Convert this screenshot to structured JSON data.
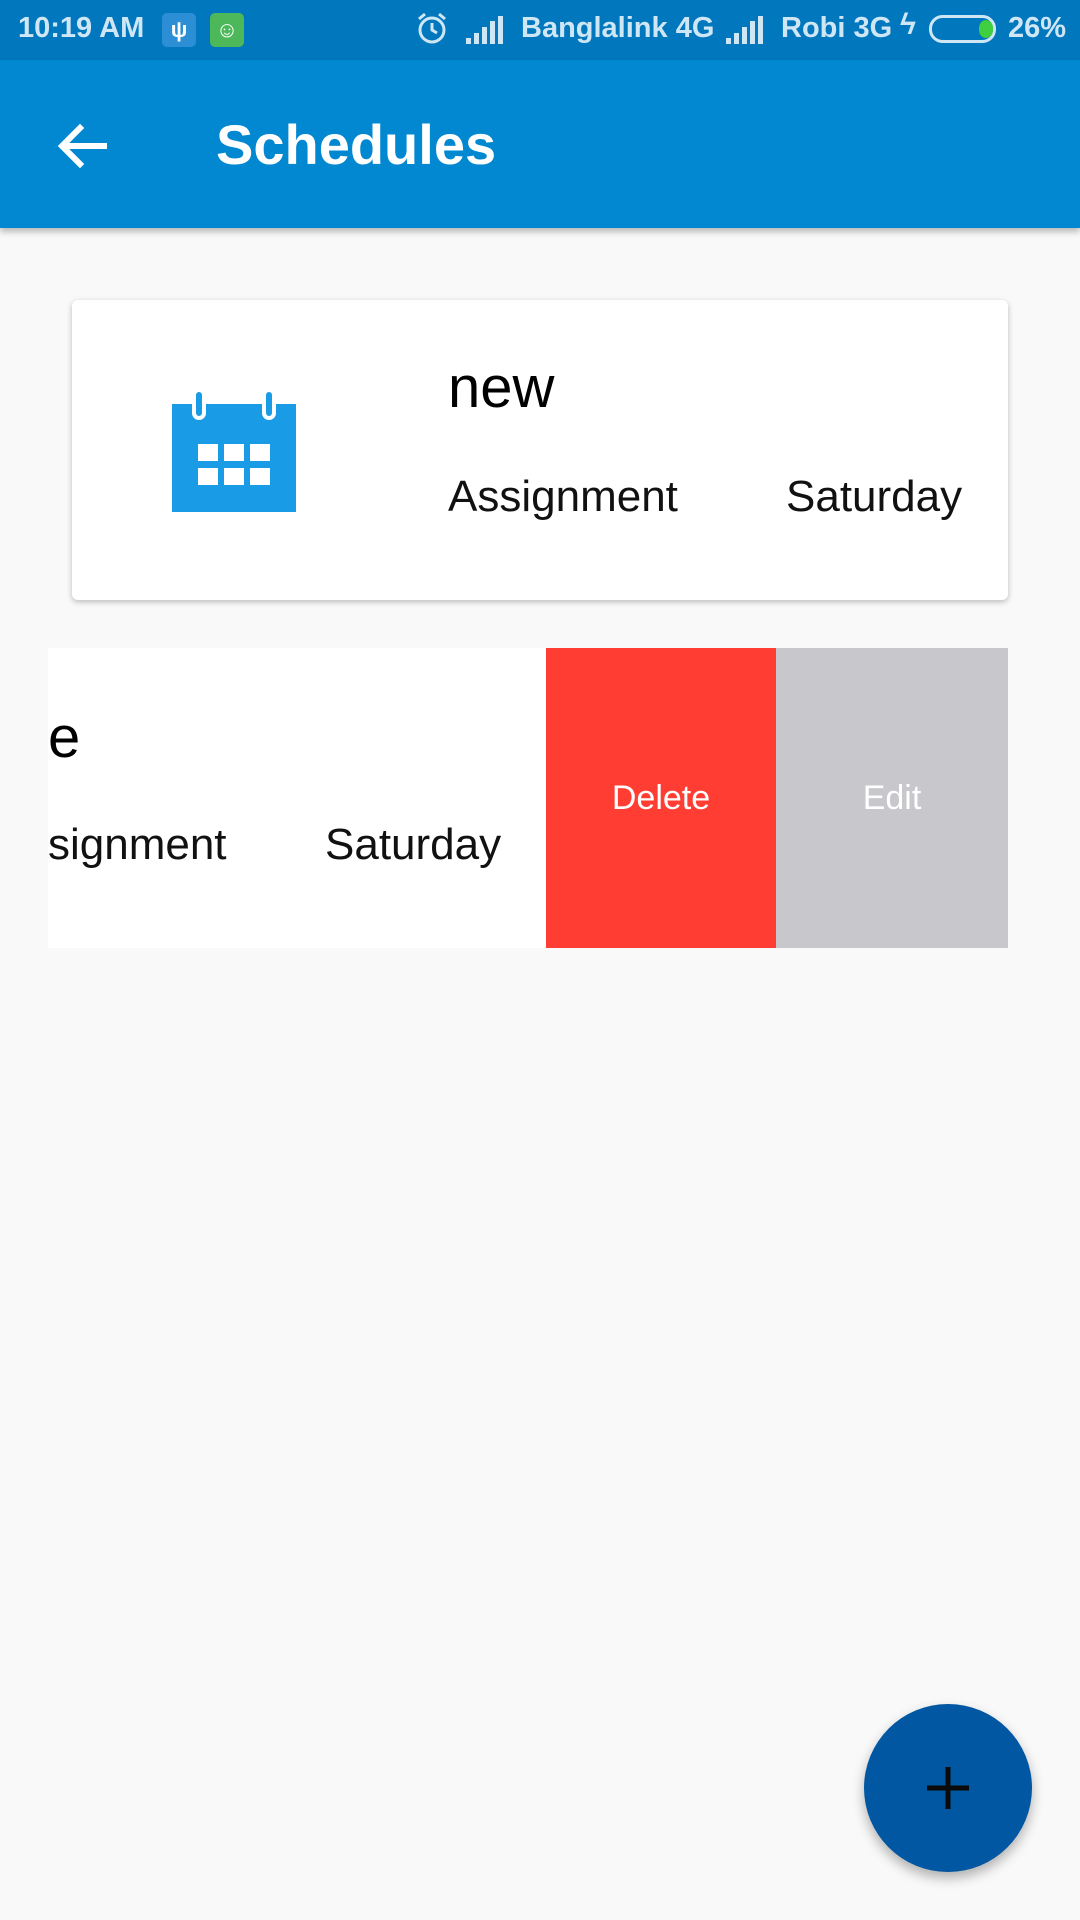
{
  "status_bar": {
    "time": "10:19 AM",
    "carrier1": "Banglalink 4G",
    "carrier2": "Robi 3G",
    "battery": "26%",
    "icons": [
      "usb-icon",
      "android-debug-icon",
      "alarm-icon",
      "signal-icon",
      "charging-icon",
      "battery-icon"
    ]
  },
  "app_bar": {
    "title": "Schedules",
    "back_icon": "arrow-back-icon"
  },
  "schedules": [
    {
      "title": "new",
      "type": "Assignment",
      "day": "Saturday",
      "icon": "calendar-icon"
    },
    {
      "title": "new",
      "type": "Assignment",
      "day": "Saturday",
      "visible_title": "e",
      "visible_type": "signment"
    }
  ],
  "swipe_actions": {
    "delete_label": "Delete",
    "edit_label": "Edit"
  },
  "fab": {
    "icon": "plus-icon"
  },
  "colors": {
    "primary": "#0288d1",
    "primary_dark": "#0177bd",
    "accent_fab": "#0157a1",
    "delete": "#ff3d33",
    "edit": "#c7c7cc",
    "calendar_icon": "#1a9be6"
  }
}
